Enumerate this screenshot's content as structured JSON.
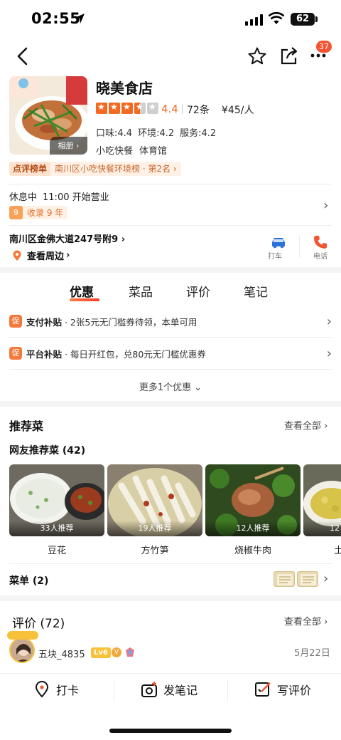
{
  "status_bar": {
    "time": "02:55",
    "battery": "62"
  },
  "nav": {
    "more_badge": "37"
  },
  "shop": {
    "name": "晓美食店",
    "rating": "4.4",
    "review_count": "72条",
    "price": "¥45/人",
    "stars_value": 4.4,
    "subscores": [
      "口味:4.4",
      "环境:4.2",
      "服务:4.2"
    ],
    "categories": [
      "小吃快餐",
      "体育馆"
    ],
    "album_label": "相册",
    "rank_label": "点评榜单",
    "rank_text": "南川区小吃快餐环境榜 · 第2名"
  },
  "hours": {
    "status": "休息中",
    "open_time": "11:00 开始营业",
    "collected": "收录 9 年"
  },
  "location": {
    "address": "南川区金佛大道247号附9",
    "nearby": "查看周边",
    "taxi_label": "打车",
    "phone_label": "电话"
  },
  "tabs": [
    {
      "label": "优惠"
    },
    {
      "label": "菜品"
    },
    {
      "label": "评价"
    },
    {
      "label": "笔记"
    }
  ],
  "promos": [
    {
      "icon": "促",
      "title": "支付补贴",
      "text": " · 2张5元无门槛券待领，本单可用"
    },
    {
      "icon": "促",
      "title": "平台补贴",
      "text": " · 每日开红包，兑80元无门槛优惠券"
    }
  ],
  "more_promos": "更多1个优惠",
  "recommend": {
    "title": "推荐菜",
    "see_all": "查看全部",
    "subtitle": "网友推荐菜 (42)",
    "dishes": [
      {
        "name": "豆花",
        "count": "33人推荐"
      },
      {
        "name": "方竹笋",
        "count": "19人推荐"
      },
      {
        "name": "烧椒牛肉",
        "count": "12人推荐"
      },
      {
        "name": "土",
        "count": "12"
      }
    ],
    "menu_label": "菜单 (2)"
  },
  "reviews": {
    "title": "评价 (72)",
    "see_all": "查看全部",
    "first": {
      "user": "五块_4835",
      "level": "Lv6",
      "date": "5月22日"
    }
  },
  "bottom_bar": {
    "checkin": "打卡",
    "note": "发笔记",
    "review": "写评价"
  },
  "colors": {
    "accent": "#f26a21",
    "brand_red": "#f25533"
  }
}
